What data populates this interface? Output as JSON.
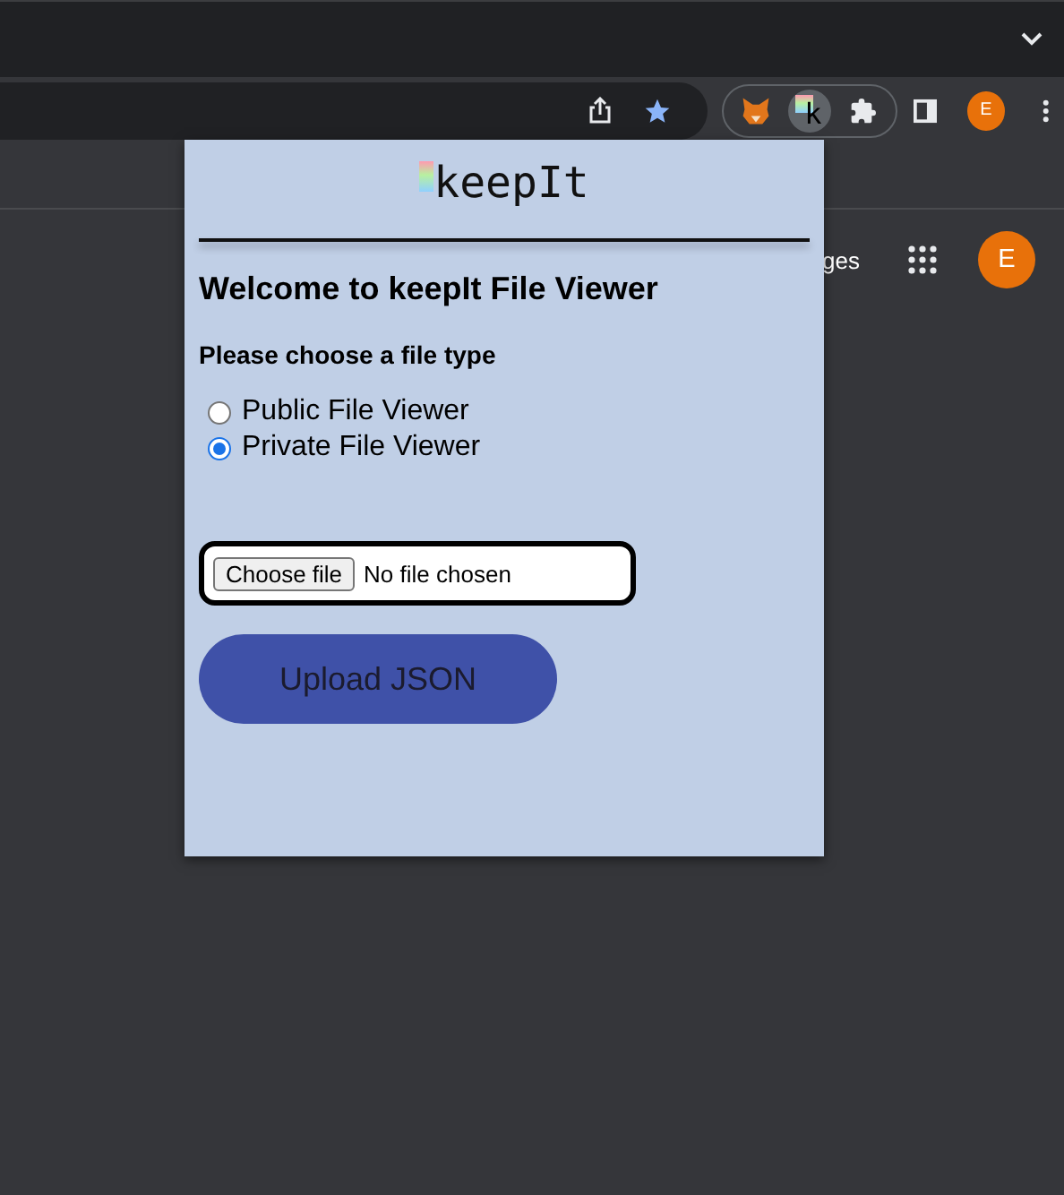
{
  "toolbar": {
    "extension_letter": "k",
    "profile_initial": "E"
  },
  "page": {
    "link_fragment": "ges",
    "profile_initial": "E"
  },
  "popup": {
    "logo": "keepIt",
    "heading": "Welcome to keepIt File Viewer",
    "prompt": "Please choose a file type",
    "file_types": [
      {
        "label": "Public File Viewer",
        "selected": false
      },
      {
        "label": "Private File Viewer",
        "selected": true
      }
    ],
    "file_picker": {
      "button": "Choose file",
      "status": "No file chosen"
    },
    "upload_button": "Upload JSON"
  }
}
